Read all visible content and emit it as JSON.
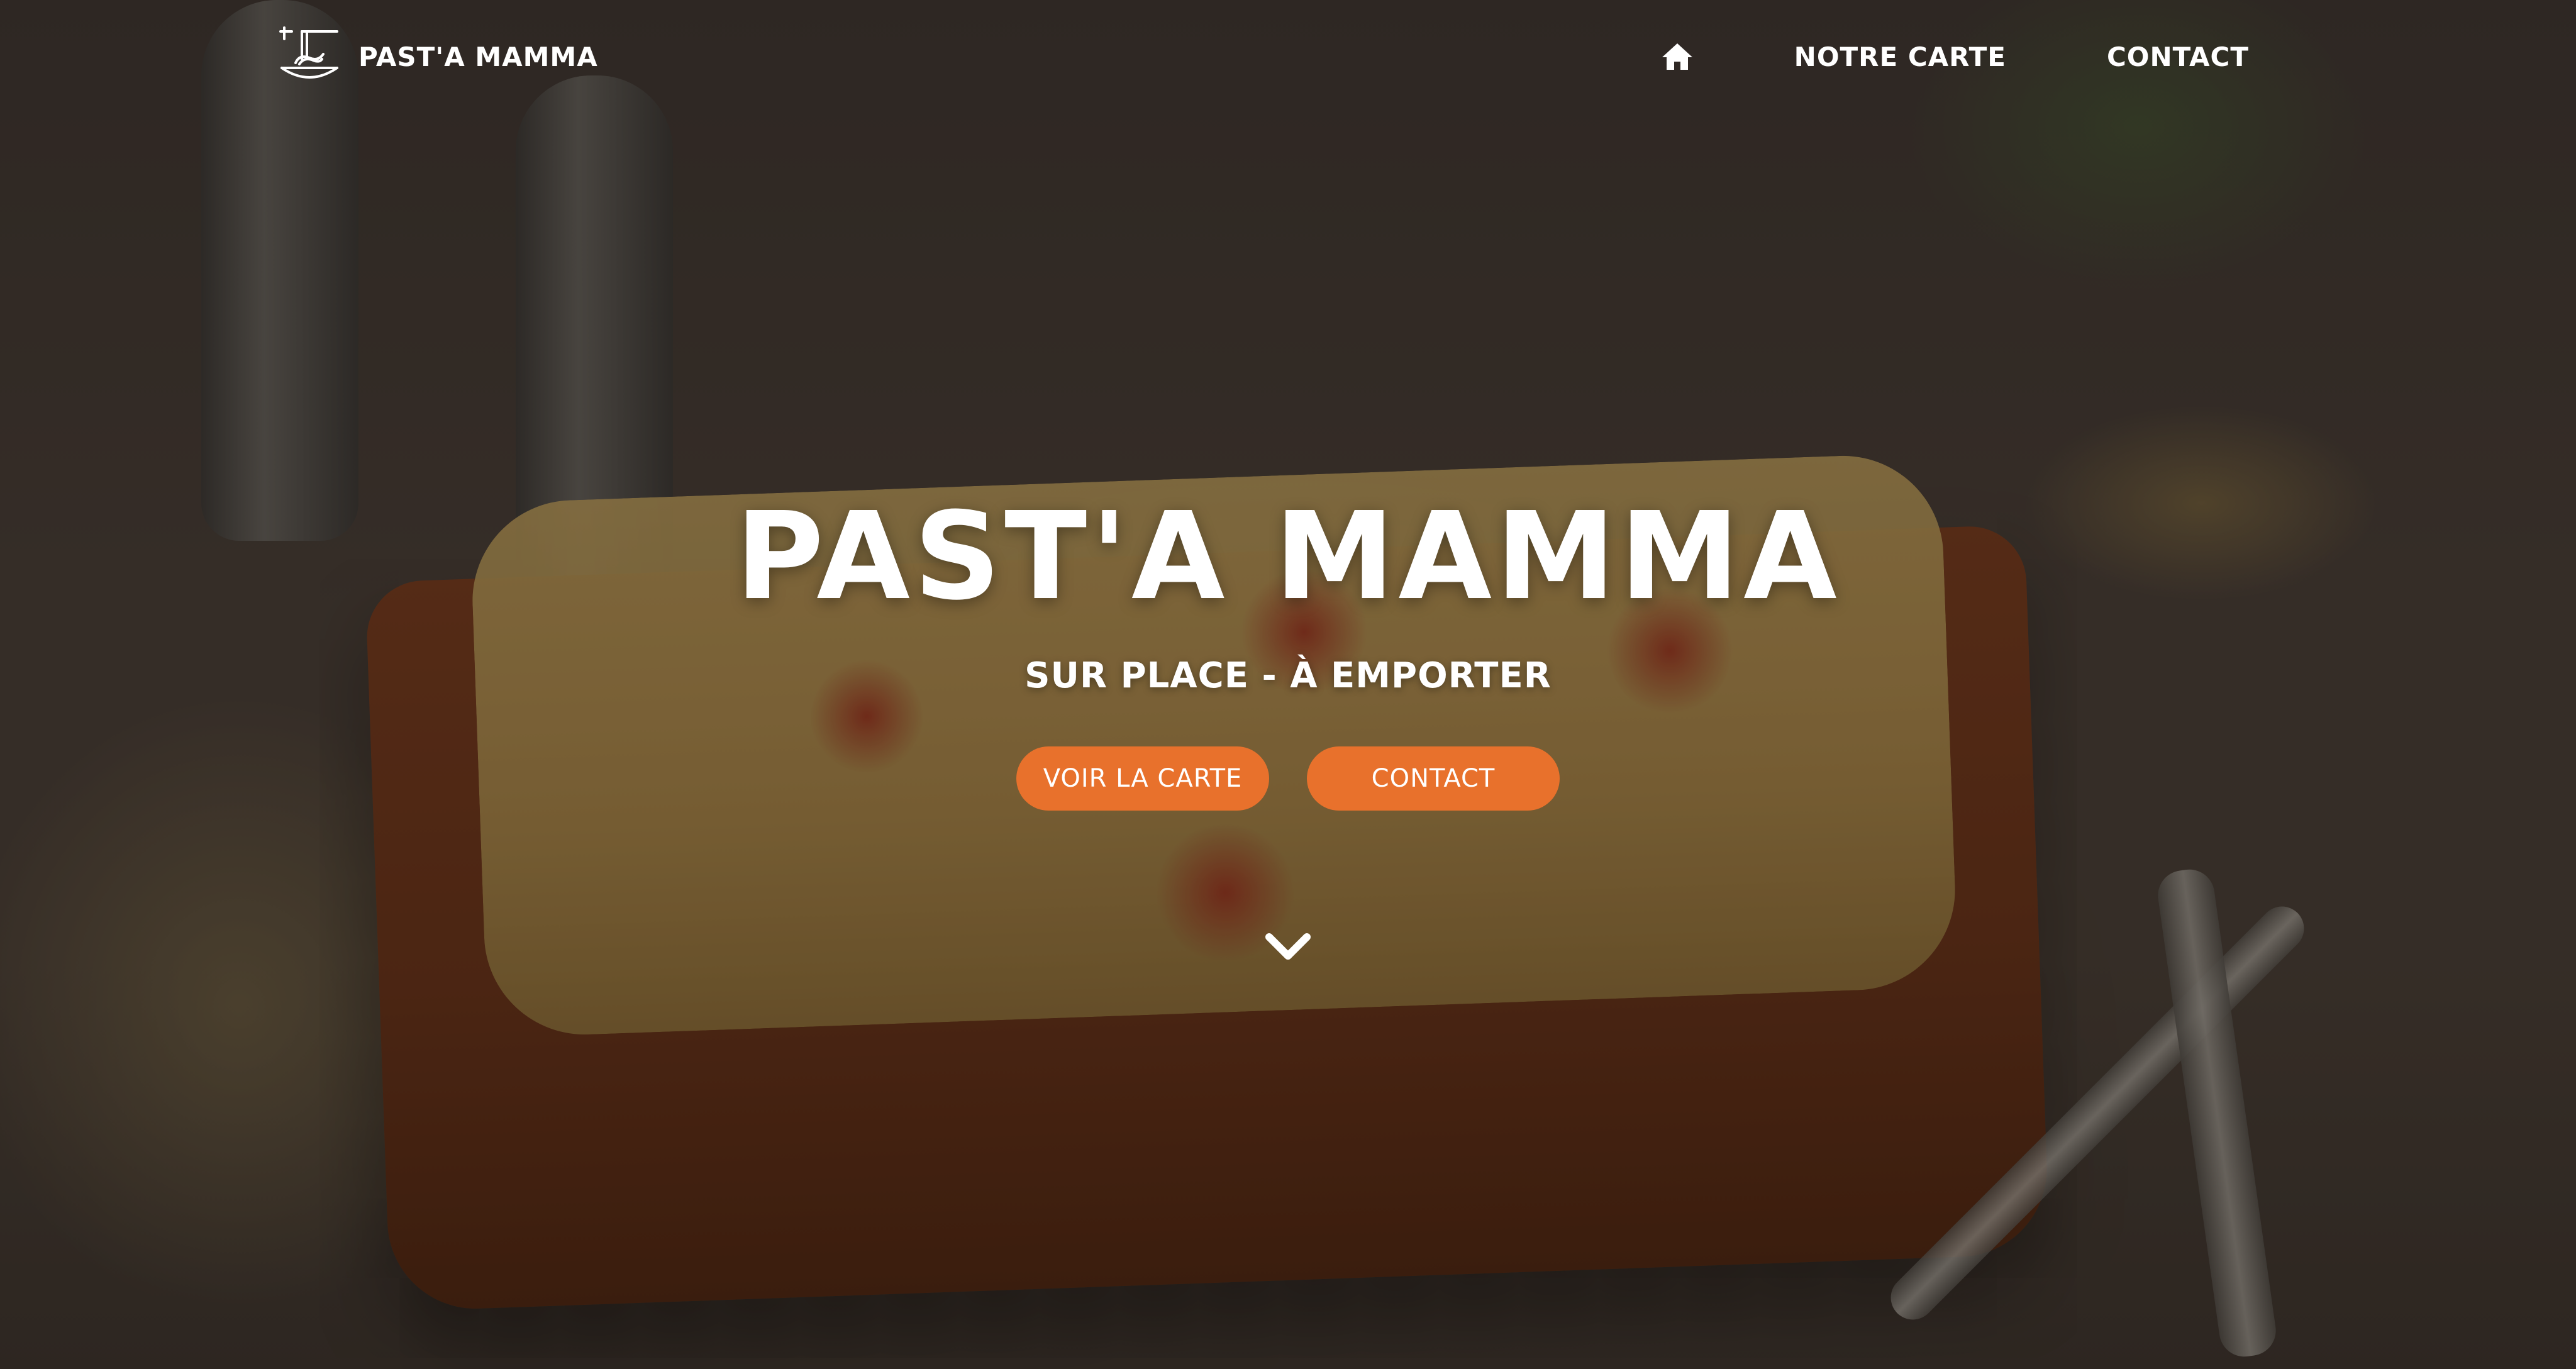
{
  "header": {
    "brand": "PAST'A MAMMA",
    "logo_icon": "pasta-bowl-icon",
    "nav": [
      {
        "icon": "home-icon",
        "label": ""
      },
      {
        "label": "NOTRE CARTE"
      },
      {
        "label": "CONTACT"
      }
    ]
  },
  "hero": {
    "title": "PAST'A MAMMA",
    "subtitle": "SUR PLACE - À EMPORTER",
    "buttons": {
      "menu_label": "VOIR LA CARTE",
      "contact_label": "CONTACT"
    },
    "scroll_icon": "chevron-down-icon"
  },
  "colors": {
    "accent": "#e8712c",
    "text": "#ffffff"
  }
}
